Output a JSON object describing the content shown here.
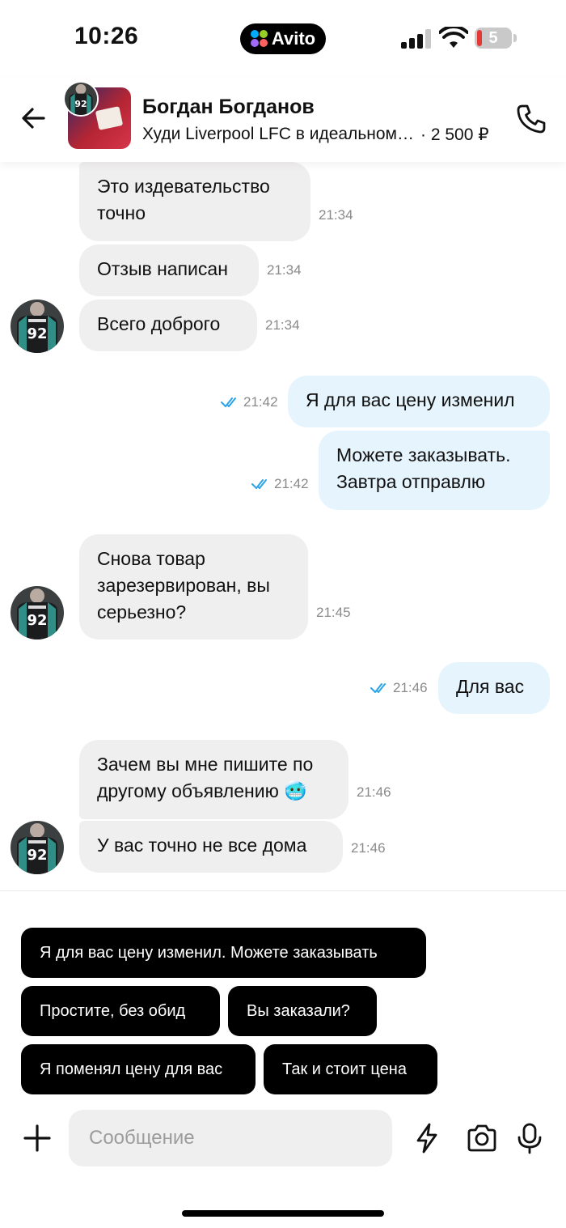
{
  "status_bar": {
    "time": "10:26",
    "app_badge": "Avito",
    "battery_level": "5"
  },
  "header": {
    "contact_name": "Богдан Богданов",
    "listing_title": "Худи Liverpool LFC в идеальном состоянии",
    "listing_price": "· 2 500 ₽"
  },
  "messages": [
    {
      "text_1": "Это издевательство",
      "text_2": "точно",
      "time": "21:34",
      "direction": "in"
    },
    {
      "text": "Отзыв написан",
      "time": "21:34",
      "direction": "in"
    },
    {
      "text": "Всего доброго",
      "time": "21:34",
      "direction": "in"
    },
    {
      "text": "Я для вас цену изменил",
      "time": "21:42",
      "direction": "out"
    },
    {
      "text_1": "Можете заказывать.",
      "text_2": "Завтра отправлю",
      "time": "21:42",
      "direction": "out"
    },
    {
      "text_1": "Снова товар",
      "text_2": "зарезервирован, вы",
      "text_3": "серьезно?",
      "time": "21:45",
      "direction": "in"
    },
    {
      "text": "Для вас",
      "time": "21:46",
      "direction": "out"
    },
    {
      "text_1": "Зачем вы мне пишите по",
      "text_2": "другому объявлению",
      "emoji": "🥶",
      "time": "21:46",
      "direction": "in"
    },
    {
      "text": "У вас точно не все дома",
      "time": "21:46",
      "direction": "in"
    }
  ],
  "avatar_jersey_number": "92",
  "quick_replies": [
    "Я для вас цену изменил. Можете заказывать",
    "Простите, без обид",
    "Вы заказали?",
    "Я поменял цену для вас",
    "Так и стоит цена"
  ],
  "composer": {
    "placeholder": "Сообщение"
  },
  "colors": {
    "incoming_bubble": "#f0efef",
    "outgoing_bubble": "#e5f4fd",
    "read_ticks": "#2aa3ea",
    "chip_bg": "#000000"
  },
  "icons": [
    "back-arrow-icon",
    "phone-icon",
    "plus-icon",
    "lightning-icon",
    "camera-icon",
    "microphone-icon",
    "double-check-icon"
  ]
}
